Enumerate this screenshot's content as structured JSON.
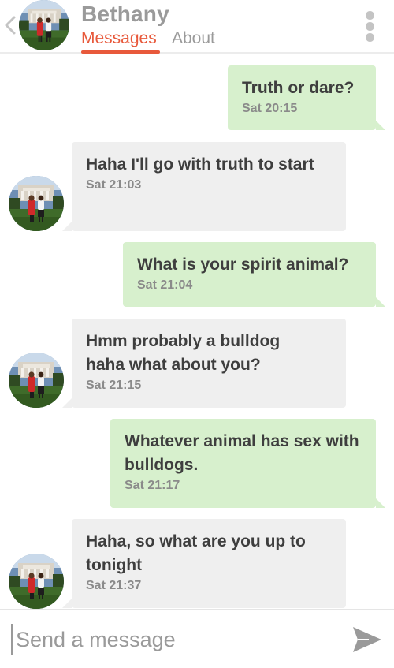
{
  "header": {
    "contact_name": "Bethany",
    "tabs": [
      {
        "label": "Messages",
        "active": true
      },
      {
        "label": "About",
        "active": false
      }
    ],
    "accent_color": "#e8593b"
  },
  "messages": [
    {
      "direction": "out",
      "text": "Truth or dare?",
      "time": "Sat 20:15"
    },
    {
      "direction": "in",
      "text": "Haha I'll go with truth to start",
      "time": "Sat 21:03"
    },
    {
      "direction": "out",
      "text": "What is your spirit animal?",
      "time": "Sat 21:04"
    },
    {
      "direction": "in",
      "text": "Hmm probably a bulldog haha what about you?",
      "time": "Sat 21:15"
    },
    {
      "direction": "out",
      "text": "Whatever animal has sex with bulldogs.",
      "time": "Sat 21:17"
    },
    {
      "direction": "in",
      "text": "Haha, so what are you up to tonight",
      "time": "Sat 21:37"
    }
  ],
  "composer": {
    "placeholder": "Send a message",
    "value": ""
  },
  "colors": {
    "outgoing_bubble": "#d7f0cd",
    "incoming_bubble": "#efefef"
  },
  "icons": {
    "back": "chevron-left-icon",
    "menu": "kebab-menu-icon",
    "send": "send-icon"
  }
}
